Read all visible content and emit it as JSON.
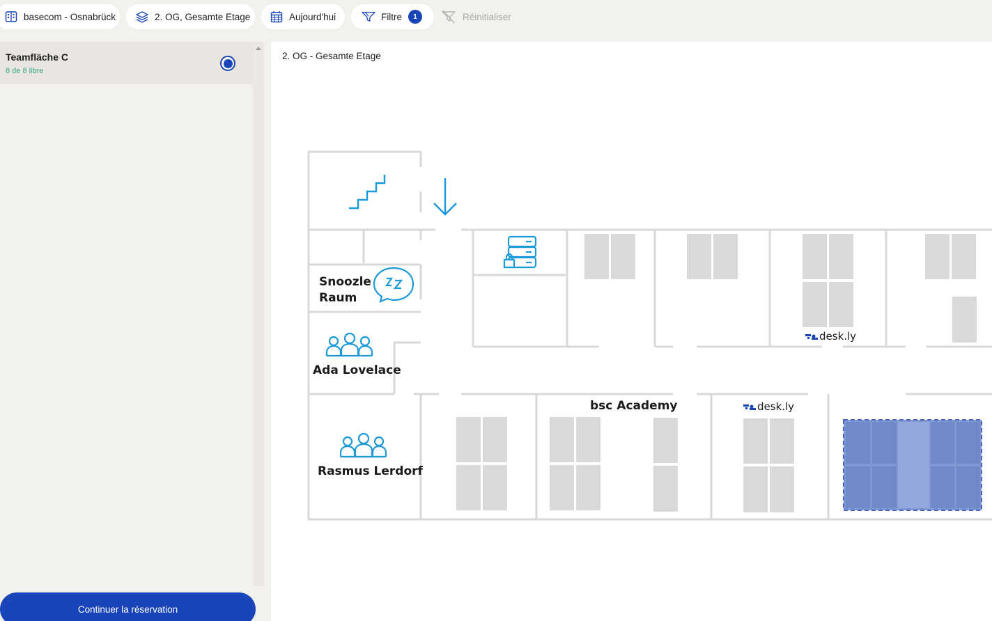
{
  "topbar": {
    "location": "basecom - Osnabrück",
    "floor": "2. OG, Gesamte Etage",
    "date": "Aujourd'hui",
    "filter_label": "Filtre",
    "filter_count": "1",
    "reset_label": "Réinitialiser"
  },
  "sidebar": {
    "area_name": "Teamfläche C",
    "area_availability": "8 de 8 libre",
    "cta": "Continuer la réservation"
  },
  "map": {
    "title": "2. OG - Gesamte Etage",
    "rooms": {
      "snoozle_line1": "Snoozle",
      "snoozle_line2": "Raum",
      "ada": "Ada Lovelace",
      "rasmus": "Rasmus Lerdorf",
      "academy": "bsc Academy",
      "brand": "desk.ly"
    }
  },
  "colors": {
    "accent": "#1a45b8",
    "available_text": "#3aa58a",
    "map_icon": "#1a9ad9",
    "selection_fill": "#7f97d3"
  }
}
